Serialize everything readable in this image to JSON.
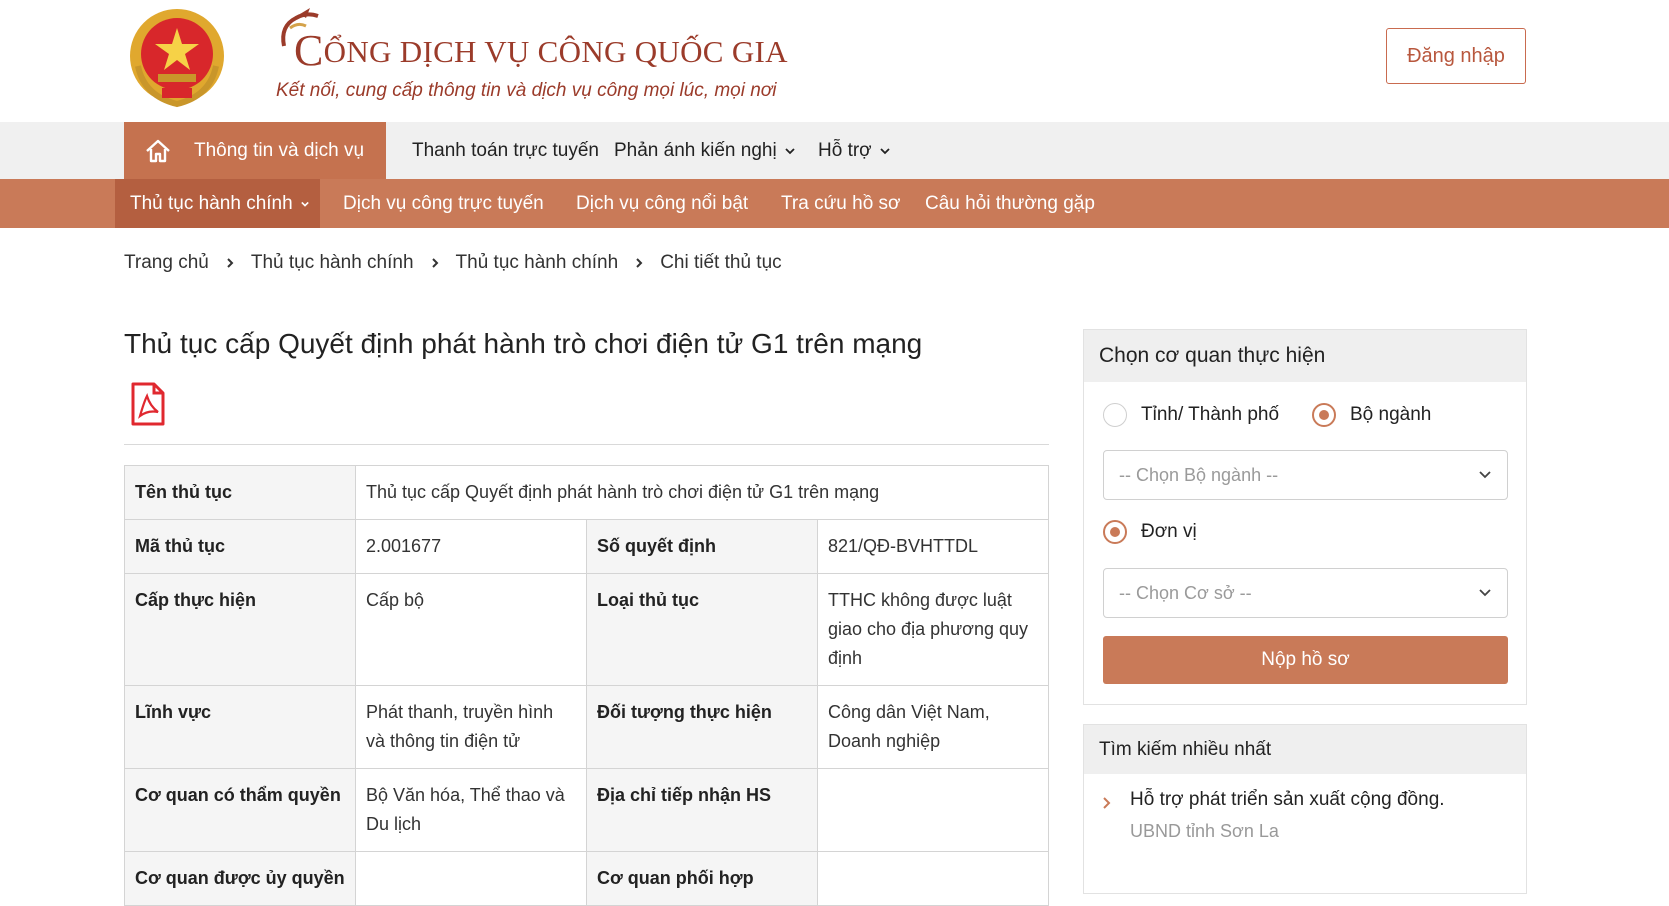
{
  "header": {
    "title_initial": "C",
    "title_rest": "ỔNG DỊCH VỤ CÔNG QUỐC GIA",
    "slogan": "Kết nối, cung cấp thông tin và dịch vụ công mọi lúc, mọi nơi",
    "login_label": "Đăng nhập"
  },
  "topnav": {
    "items": [
      {
        "label": "Thông tin và dịch vụ"
      },
      {
        "label": "Thanh toán trực tuyến"
      },
      {
        "label": "Phản ánh kiến nghị"
      },
      {
        "label": "Hỗ trợ"
      }
    ]
  },
  "subnav": {
    "items": [
      {
        "label": "Thủ tục hành chính"
      },
      {
        "label": "Dịch vụ công trực tuyến"
      },
      {
        "label": "Dịch vụ công nổi bật"
      },
      {
        "label": "Tra cứu hồ sơ"
      },
      {
        "label": "Câu hỏi thường gặp"
      }
    ]
  },
  "breadcrumb": [
    "Trang chủ",
    "Thủ tục hành chính",
    "Thủ tục hành chính",
    "Chi tiết thủ tục"
  ],
  "main": {
    "title": "Thủ tục cấp Quyết định phát hành trò chơi điện tử G1 trên mạng",
    "table": {
      "ten_thu_tuc": {
        "label": "Tên thủ tục",
        "value": "Thủ tục cấp Quyết định phát hành trò chơi điện tử G1 trên mạng"
      },
      "ma_thu_tuc": {
        "label": "Mã thủ tục",
        "value": "2.001677"
      },
      "so_quyet_dinh": {
        "label": "Số quyết định",
        "value": "821/QĐ-BVHTTDL"
      },
      "cap_thuc_hien": {
        "label": "Cấp thực hiện",
        "value": "Cấp bộ"
      },
      "loai_thu_tuc": {
        "label": "Loại thủ tục",
        "value": "TTHC không được luật giao cho địa phương quy định"
      },
      "linh_vuc": {
        "label": "Lĩnh vực",
        "value": "Phát thanh, truyền hình và thông tin điện tử"
      },
      "doi_tuong": {
        "label": "Đối tượng thực hiện",
        "value": "Công dân Việt Nam, Doanh nghiệp"
      },
      "co_quan_tham_quyen": {
        "label": "Cơ quan có thẩm quyền",
        "value": "Bộ Văn hóa, Thể thao và Du lịch"
      },
      "dia_chi_tiep_nhan": {
        "label": "Địa chỉ tiếp nhận HS",
        "value": ""
      },
      "co_quan_uy_quyen": {
        "label": "Cơ quan được ủy quyền",
        "value": ""
      },
      "co_quan_phoi_hop": {
        "label": "Cơ quan phối hợp",
        "value": ""
      }
    }
  },
  "sidebar": {
    "panel_title": "Chọn cơ quan thực hiện",
    "radio_province": "Tỉnh/ Thành phố",
    "radio_ministry": "Bộ ngành",
    "ministry_placeholder": "-- Chọn Bộ ngành --",
    "radio_unit": "Đơn vị",
    "unit_placeholder": "-- Chọn Cơ sở --",
    "submit_label": "Nộp hồ sơ",
    "selected": {
      "province": false,
      "ministry": true,
      "unit": true
    },
    "top_search_title": "Tìm kiếm nhiều nhất",
    "top_search_items": [
      {
        "title": "Hỗ trợ phát triển sản xuất cộng đồng.",
        "agency": "UBND tỉnh Sơn La"
      }
    ]
  },
  "colors": {
    "brand": "#c97a58",
    "brand_dark": "#b45f40",
    "title_red": "#9b3b2a"
  },
  "icons": [
    "national-emblem-icon",
    "portal-logo-icon",
    "home-icon",
    "chevron-down-icon",
    "chevron-right-icon",
    "pdf-icon"
  ]
}
